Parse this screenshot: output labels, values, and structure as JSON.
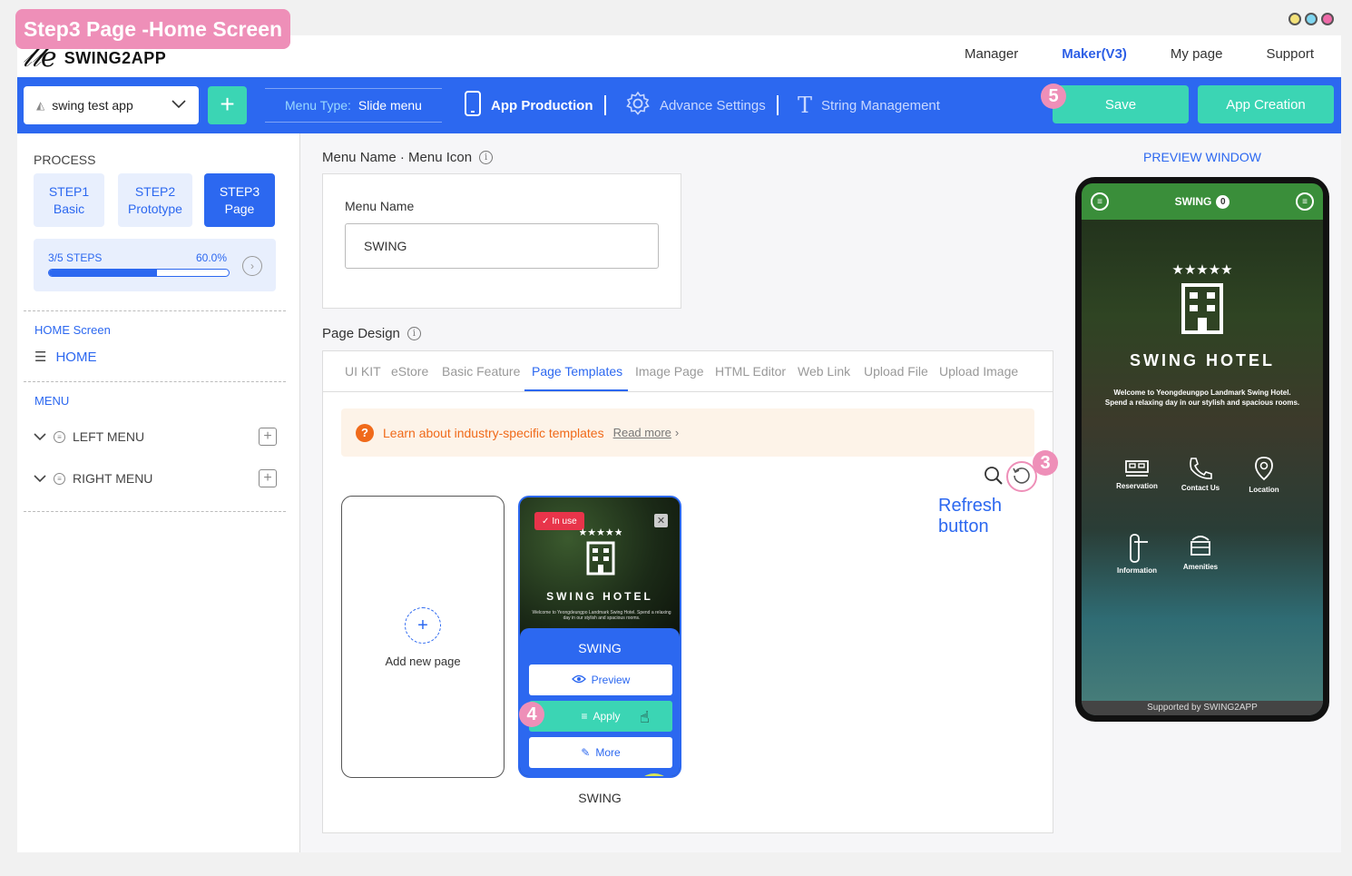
{
  "banner": "Step3 Page -Home Screen",
  "logo": {
    "name": "SWING2APP"
  },
  "nav": {
    "items": [
      "Manager",
      "Maker(V3)",
      "My page",
      "Support"
    ],
    "active": "Maker(V3)"
  },
  "toolbar": {
    "app_name": "swing test app",
    "add_label": "+",
    "menu_type_label": "Menu Type:",
    "menu_type_value": "Slide menu",
    "app_production": "App Production",
    "advance_settings": "Advance Settings",
    "string_management": "String Management",
    "save": "Save",
    "app_creation": "App Creation"
  },
  "badges": {
    "save": "5",
    "refresh": "3",
    "apply": "4"
  },
  "sidebar": {
    "process_title": "PROCESS",
    "steps": [
      {
        "line1": "STEP1",
        "line2": "Basic"
      },
      {
        "line1": "STEP2",
        "line2": "Prototype"
      },
      {
        "line1": "STEP3",
        "line2": "Page"
      }
    ],
    "progress": {
      "label": "3/5 STEPS",
      "percent_text": "60.0%",
      "value": 0.6
    },
    "home_section": "HOME Screen",
    "home_item": "HOME",
    "menu_section": "MENU",
    "menu_items": [
      "LEFT MENU",
      "RIGHT MENU"
    ]
  },
  "menu_name_section": {
    "title": "Menu Name · Menu Icon",
    "label": "Menu Name",
    "value": "SWING"
  },
  "page_design": {
    "title": "Page Design",
    "tabs": [
      "UI KIT",
      "eStore",
      "Basic Feature",
      "Page Templates",
      "Image Page",
      "HTML Editor",
      "Web Link",
      "Upload File",
      "Upload Image"
    ],
    "active_tab": "Page Templates",
    "notice": "Learn about industry-specific templates",
    "read_more": "Read more",
    "refresh_label": "Refresh button",
    "add_new_page": "Add new page",
    "template": {
      "in_use": "In use",
      "hotel_name": "SWING HOTEL",
      "hotel_sub": "Welcome to Yeongdeungpo Landmark Swing Hotel. Spend a relaxing day in our stylish and spacious rooms.",
      "name": "SWING",
      "preview": "Preview",
      "apply": "Apply",
      "more": "More",
      "caption": "SWING"
    }
  },
  "preview": {
    "title": "PREVIEW WINDOW",
    "app_title": "SWING",
    "count": "0",
    "hotel_name": "SWING HOTEL",
    "hotel_sub_1": "Welcome to Yeongdeungpo Landmark Swing Hotel.",
    "hotel_sub_2": "Spend a relaxing day in our stylish and spacious rooms.",
    "icons": [
      "Reservation",
      "Contact Us",
      "Location",
      "Information",
      "Amenities"
    ],
    "footer": "Supported by SWING2APP"
  },
  "colors": {
    "primary": "#2c68f0",
    "accent": "#3bd5b4",
    "badge": "#ee8fb8",
    "notice": "#f06a1a"
  }
}
